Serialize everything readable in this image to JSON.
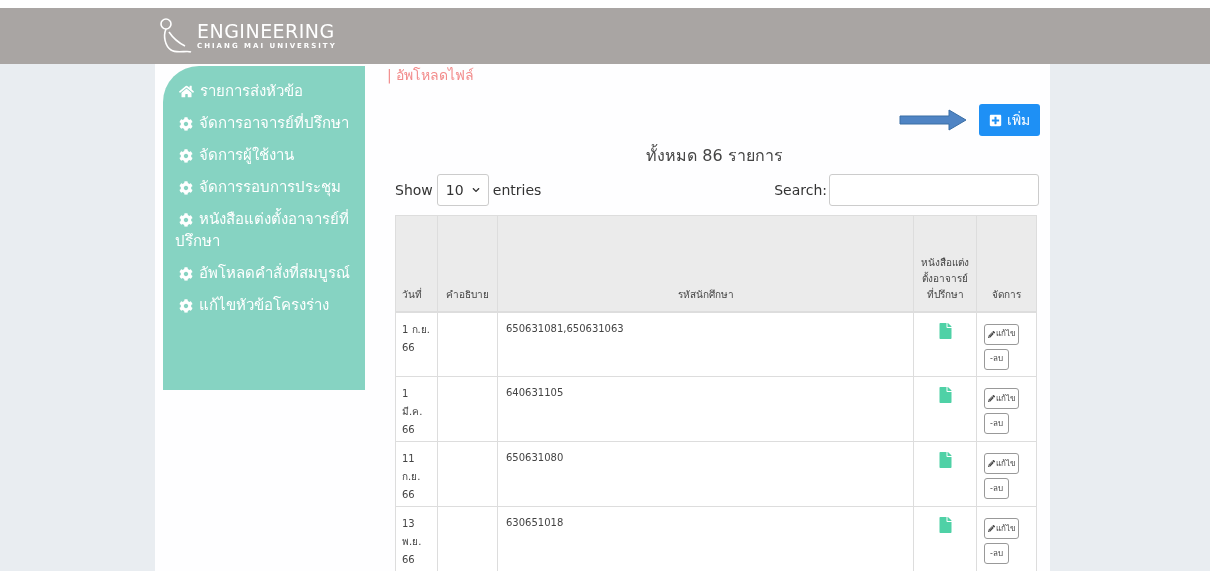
{
  "header": {
    "logo_title": "ENGINEERING",
    "logo_subtitle": "CHIANG MAI UNIVERSITY"
  },
  "sidebar": {
    "items": [
      {
        "label": "รายการส่งหัวข้อ",
        "kind": "home"
      },
      {
        "label": "จัดการอาจารย์ที่ปรึกษา",
        "kind": "gear"
      },
      {
        "label": "จัดการผู้ใช้งาน",
        "kind": "gear"
      },
      {
        "label": "จัดการรอบการประชุม",
        "kind": "gear"
      },
      {
        "label": "หนังสือแต่งตั้งอาจารย์ที่ปรึกษา",
        "kind": "gear"
      },
      {
        "label": "อัพโหลดคำสั่งที่สมบูรณ์",
        "kind": "gear"
      },
      {
        "label": "แก้ไขหัวข้อโครงร่าง",
        "kind": "gear"
      }
    ]
  },
  "breadcrumb": "| อัพโหลดไฟล์",
  "add_button": "เพิ่ม",
  "total": "ทั้งหมด 86 รายการ",
  "length_control": {
    "prefix": "Show",
    "value": "10",
    "suffix": "entries"
  },
  "search": {
    "label": "Search:"
  },
  "table": {
    "columns": [
      "วันที่",
      "คำอธิบาย",
      "รหัสนักศึกษา",
      "หนังสือแต่งตั้งอาจารย์ที่ปรึกษา",
      "จัดการ"
    ],
    "rows": [
      {
        "date": "1 ก.ย. 66",
        "student_ids": "650631081,650631063",
        "edit": "แก้ไข",
        "delete": "-ลบ"
      },
      {
        "date": "1 มี.ค. 66",
        "student_ids": "640631105",
        "edit": "แก้ไข",
        "delete": "-ลบ"
      },
      {
        "date": "11 ก.ย. 66",
        "student_ids": "650631080",
        "edit": "แก้ไข",
        "delete": "-ลบ"
      },
      {
        "date": "13 พ.ย. 66",
        "student_ids": "630651018",
        "edit": "แก้ไข",
        "delete": "-ลบ"
      }
    ]
  }
}
